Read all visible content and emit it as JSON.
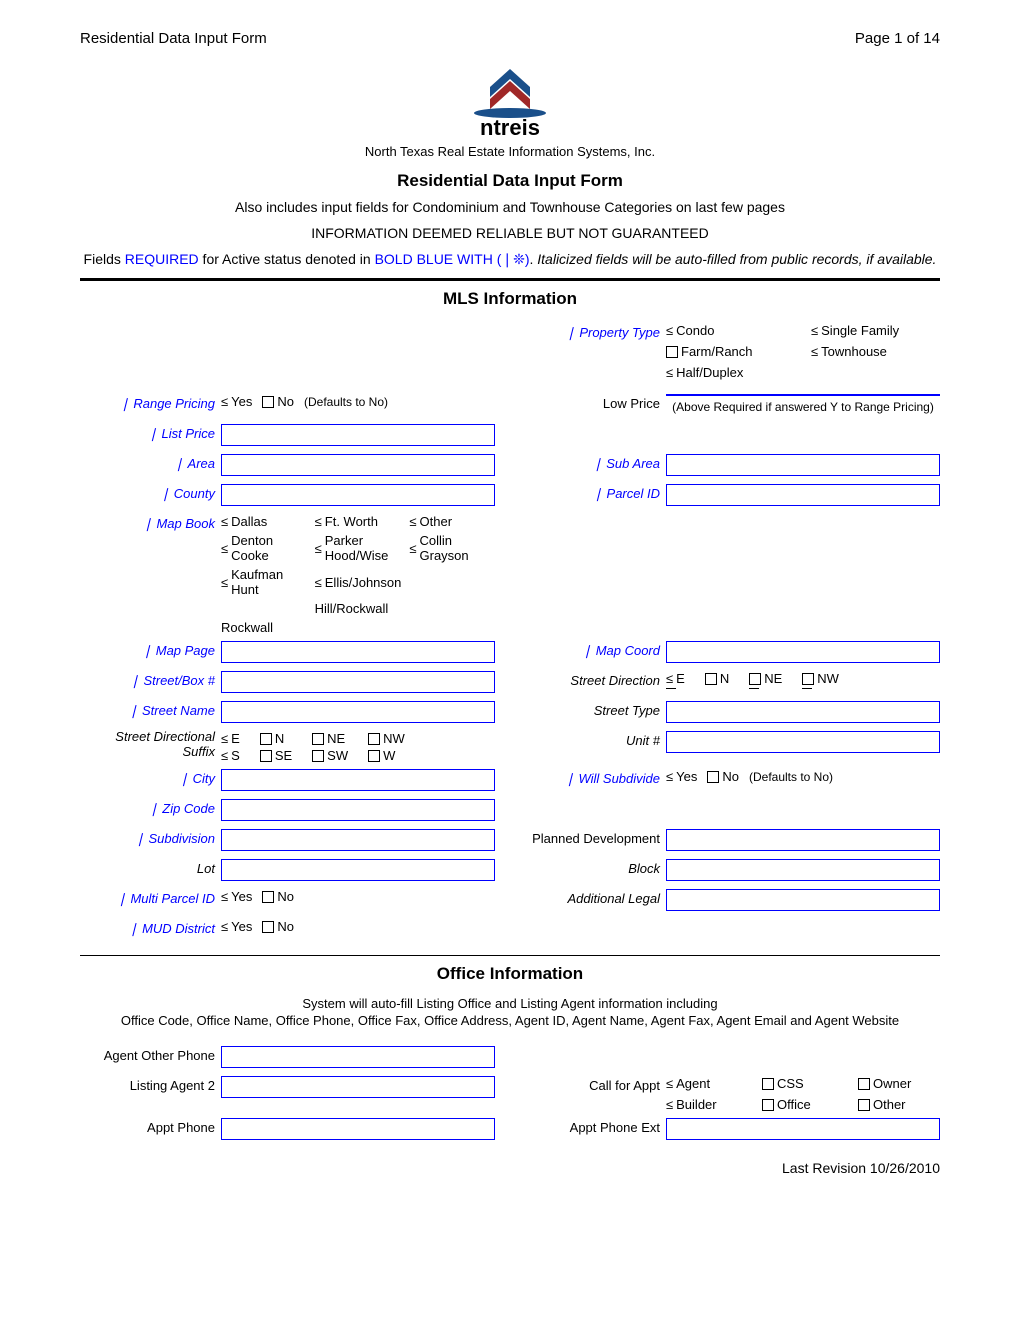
{
  "header": {
    "left": "Residential Data Input Form",
    "right": "Page 1 of 14",
    "logo_text": "ntreis",
    "company": "North Texas Real Estate Information Systems, Inc.",
    "title": "Residential Data Input Form",
    "sub1": "Also includes input fields for Condominium and Townhouse Categories on last few pages",
    "sub2": "INFORMATION DEEMED RELIABLE BUT NOT GUARANTEED",
    "sub3_prefix": "Fields ",
    "sub3_req": "REQUIRED",
    "sub3_mid": " for Active status denoted in ",
    "sub3_bold": "BOLD BLUE WITH (❘❊)",
    "sub3_dot": ".  ",
    "sub3_italic": "Italicized fields will be auto-filled from public records, if available."
  },
  "mls": {
    "title": "MLS Information",
    "property_type": {
      "label": "Property Type",
      "condo": "Condo",
      "single_family": "Single Family",
      "farm_ranch": "Farm/Ranch",
      "townhouse": "Townhouse",
      "half_duplex": "Half/Duplex"
    },
    "range_pricing": {
      "label": "Range Pricing",
      "yes": "Yes",
      "no": "No",
      "default": "(Defaults to No)"
    },
    "low_price": {
      "label": "Low Price",
      "note": "(Above Required if answered Y to Range Pricing)"
    },
    "list_price": "List Price",
    "area": "Area",
    "sub_area": "Sub Area",
    "county": "County",
    "parcel_id": "Parcel ID",
    "map_book": {
      "label": "Map Book",
      "dallas": "Dallas",
      "ftworth": "Ft. Worth",
      "other": "Other",
      "denton_cooke": "Denton Cooke",
      "parker_hood_wise": "Parker Hood/Wise",
      "collin_grayson": "Collin Grayson",
      "kaufman_hunt": "Kaufman Hunt",
      "ellis_johnson": "Ellis/Johnson",
      "hill_rockwall": "Hill/Rockwall",
      "rockwall": "Rockwall"
    },
    "map_page": "Map Page",
    "map_coord": "Map Coord",
    "street_box": "Street/Box #",
    "street_direction": {
      "label": "Street Direction",
      "e": "E",
      "n": "N",
      "ne": "NE",
      "nw": "NW"
    },
    "street_name": "Street Name",
    "street_type": "Street Type",
    "street_dir_suffix": {
      "label": "Street Directional Suffix",
      "e": "E",
      "n": "N",
      "ne": "NE",
      "nw": "NW",
      "s": "S",
      "se": "SE",
      "sw": "SW",
      "w": "W"
    },
    "unit_no": "Unit #",
    "city": "City",
    "will_subdivide": {
      "label": "Will Subdivide",
      "yes": "Yes",
      "no": "No",
      "default": "(Defaults to No)"
    },
    "zip_code": "Zip Code",
    "subdivision": "Subdivision",
    "planned_dev": "Planned Development",
    "lot": "Lot",
    "block": "Block",
    "multi_parcel": {
      "label": "Multi Parcel ID",
      "yes": "Yes",
      "no": "No"
    },
    "additional_legal": "Additional Legal",
    "mud_district": {
      "label": "MUD District",
      "yes": "Yes",
      "no": "No"
    }
  },
  "office": {
    "title": "Office Information",
    "sub1": "System will auto-fill Listing Office and Listing Agent information including",
    "sub2": "Office Code, Office Name, Office Phone, Office Fax, Office Address, Agent ID, Agent Name, Agent Fax, Agent Email and Agent Website",
    "agent_other_phone": "Agent Other Phone",
    "listing_agent_2": "Listing Agent 2",
    "call_for_appt": {
      "label": "Call for Appt",
      "agent": "Agent",
      "css": "CSS",
      "owner": "Owner",
      "builder": "Builder",
      "office": "Office",
      "other": "Other"
    },
    "appt_phone": "Appt Phone",
    "appt_phone_ext": "Appt Phone Ext"
  },
  "footer": "Last Revision 10/26/2010"
}
